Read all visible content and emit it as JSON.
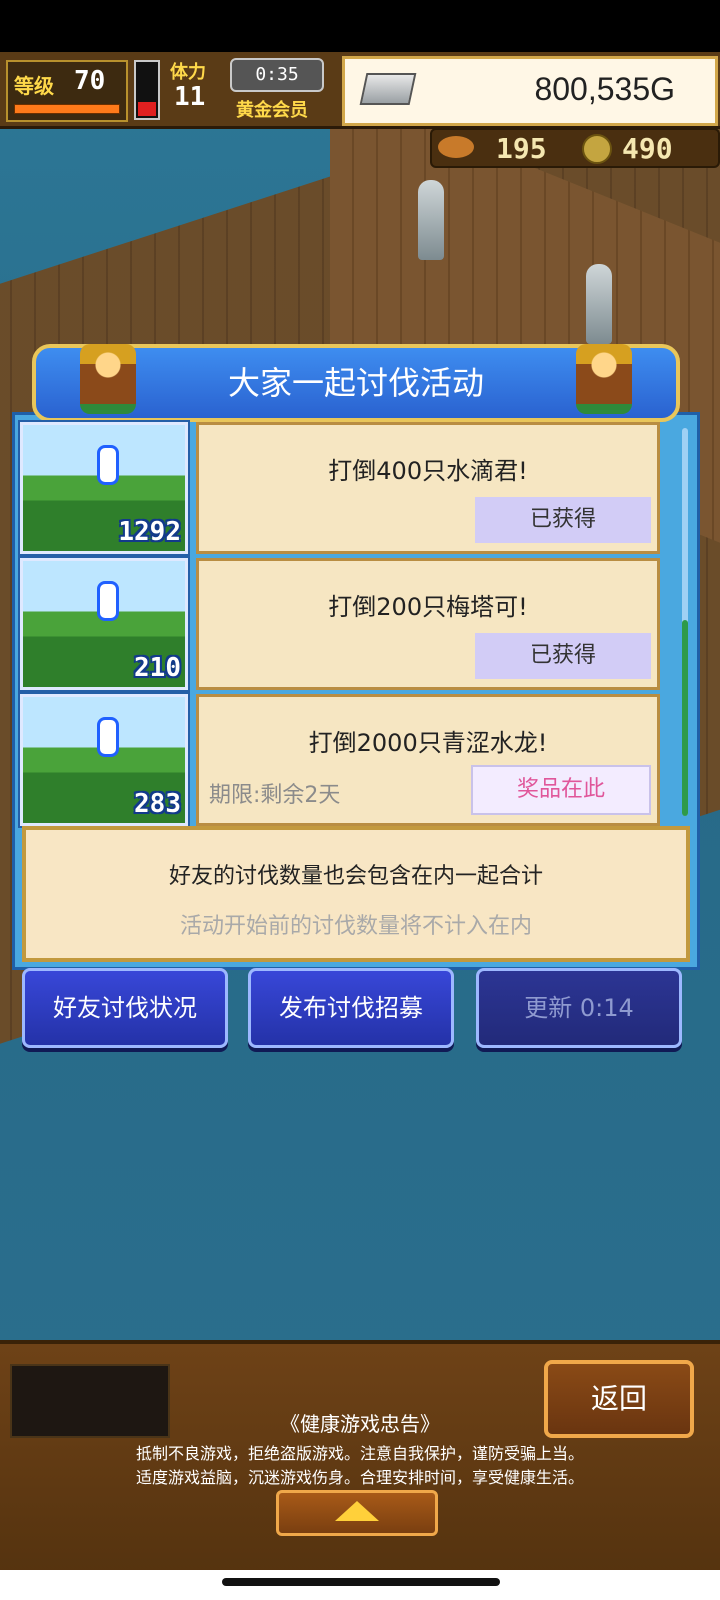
{
  "hud": {
    "level_label": "等级",
    "level_value": "70",
    "stamina_label": "体力",
    "stamina_value": "11",
    "timer": "0:35",
    "membership": "黄金会员",
    "gold": "800,535G",
    "resource1": "195",
    "resource2": "490"
  },
  "dialog": {
    "title": "大家一起讨伐活动",
    "quests": [
      {
        "thumb_count": "1292",
        "title": "打倒400只水滴君!",
        "status": "已获得",
        "deadline": ""
      },
      {
        "thumb_count": "210",
        "title": "打倒200只梅塔可!",
        "status": "已获得",
        "deadline": ""
      },
      {
        "thumb_count": "283",
        "title": "打倒2000只青涩水龙!",
        "status": "奖品在此",
        "deadline": "期限:剩余2天"
      }
    ],
    "note_main": "好友的讨伐数量也会包含在内一起合计",
    "note_sub": "活动开始前的讨伐数量将不计入在内"
  },
  "buttons": {
    "friends_status": "好友讨伐状况",
    "post_recruit": "发布讨伐招募",
    "refresh": "更新 0:14"
  },
  "bottom": {
    "back": "返回",
    "health_title": "《健康游戏忠告》",
    "health_line1": "抵制不良游戏，拒绝盗版游戏。注意自我保护，谨防受骗上当。",
    "health_line2": "适度游戏益脑，沉迷游戏伤身。合理安排时间，享受健康生活。"
  },
  "colors": {
    "accent_blue": "#2a62d0",
    "gold_border": "#e9c65a",
    "prize_pink": "#e0569a"
  }
}
